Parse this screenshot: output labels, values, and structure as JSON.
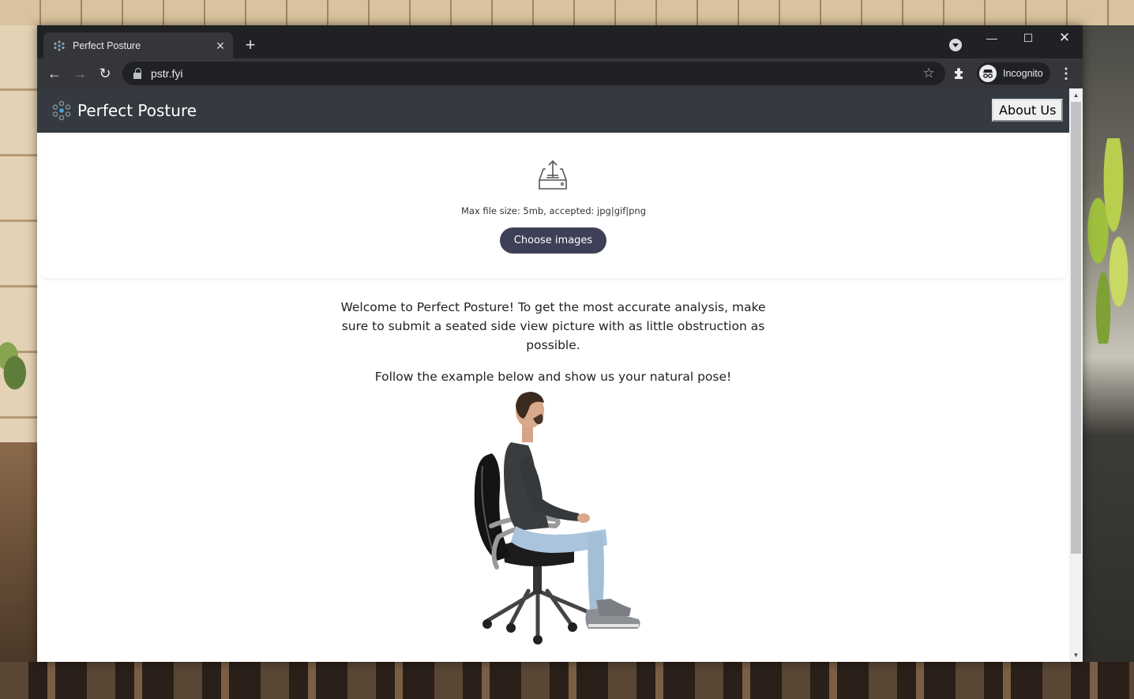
{
  "browser": {
    "tab_title": "Perfect Posture",
    "url": "pstr.fyi",
    "profile_label": "Incognito"
  },
  "site": {
    "brand_name": "Perfect Posture",
    "about_button": "About Us"
  },
  "upload": {
    "hint": "Max file size: 5mb, accepted: jpg|gif|png",
    "button": "Choose images"
  },
  "intro": {
    "paragraph_1": "Welcome to Perfect Posture! To get the most accurate analysis, make sure to submit a seated side view picture with as little obstruction as possible.",
    "paragraph_2": "Follow the example below and show us your natural pose!"
  },
  "colors": {
    "header_bg": "#343a40",
    "button_bg": "#3e4057",
    "chrome_dark": "#202124",
    "chrome_toolbar": "#35363a"
  }
}
